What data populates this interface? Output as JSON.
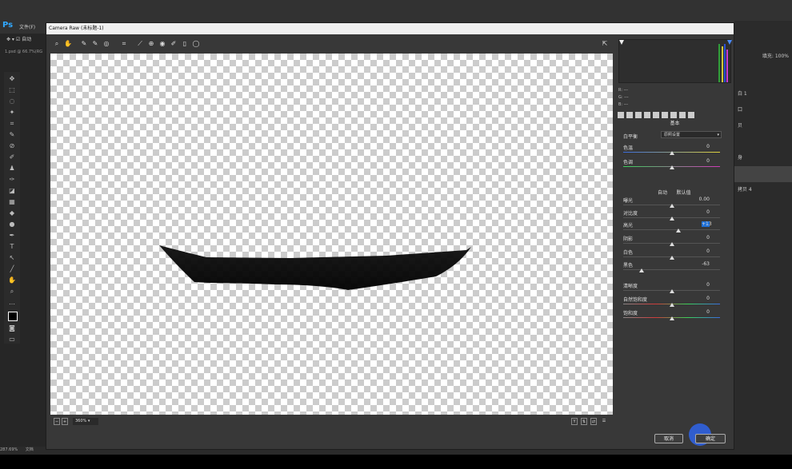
{
  "ps": {
    "logo": "Ps",
    "menu_file": "文件(F)",
    "option_auto": "自动",
    "doc_tab": "1.psd @ 66.7%(RG",
    "status_zoom": "287.69%",
    "status_doc": "文档"
  },
  "dialog": {
    "title": "Camera Raw (未标题-1)",
    "zoom": "360%",
    "cancel": "取消",
    "ok": "确定"
  },
  "readout": {
    "r": "R: ---",
    "g": "G: ---",
    "b": "B: ---"
  },
  "panel": {
    "title": "基本",
    "white_balance_label": "白平衡",
    "white_balance_value": "原照设置",
    "auto": "自动",
    "default": "默认值",
    "sliders": [
      {
        "label": "色温",
        "value": "0",
        "level": 0.5
      },
      {
        "label": "色调",
        "value": "0",
        "level": 0.5
      },
      {
        "label": "曝光",
        "value": "0.00",
        "level": 0.5
      },
      {
        "label": "对比度",
        "value": "0",
        "level": 0.5
      },
      {
        "label": "高光",
        "value": "+13",
        "level": 0.57
      },
      {
        "label": "阴影",
        "value": "0",
        "level": 0.5
      },
      {
        "label": "白色",
        "value": "0",
        "level": 0.5
      },
      {
        "label": "黑色",
        "value": "-63",
        "level": 0.19
      },
      {
        "label": "清晰度",
        "value": "0",
        "level": 0.5
      },
      {
        "label": "自然饱和度",
        "value": "0",
        "level": 0.5
      },
      {
        "label": "饱和度",
        "value": "0",
        "level": 0.5
      }
    ]
  },
  "right_panel": {
    "zoom": "填充: 100%",
    "layer1": "白 1",
    "layer2": "口",
    "layer3": "贝",
    "layer4": "身",
    "layer5": "拷贝 4"
  },
  "colors": {
    "accent": "#31a8ff",
    "cursor": "#2f5fd6",
    "highlight_value_bg": "#1e6fd6"
  }
}
